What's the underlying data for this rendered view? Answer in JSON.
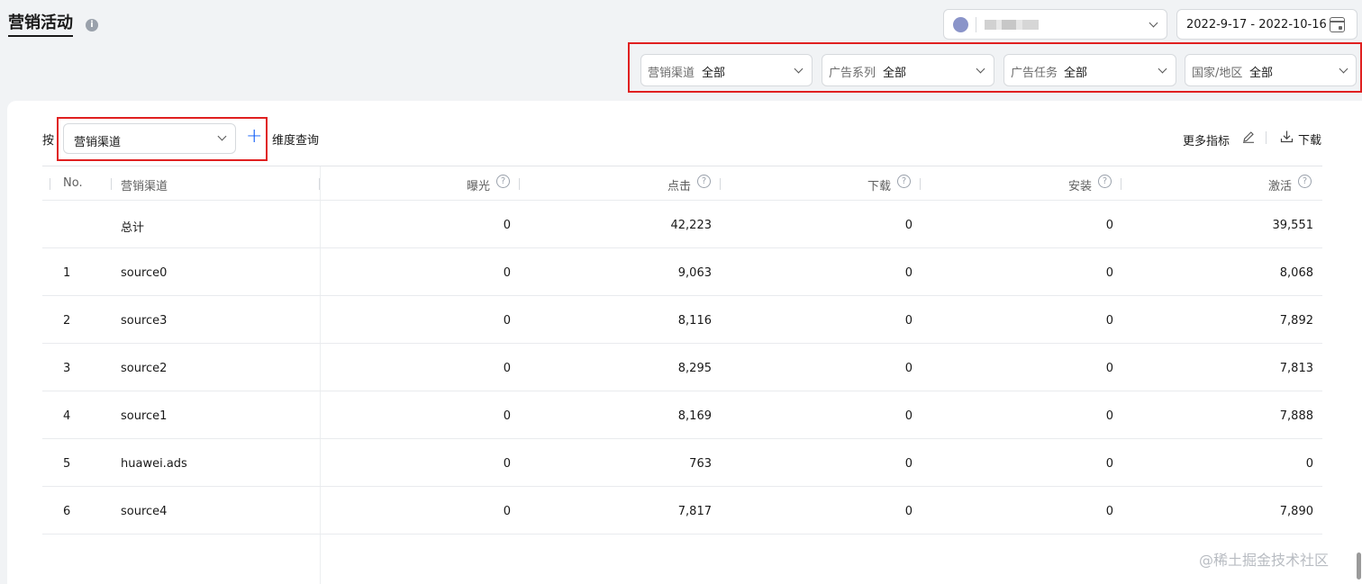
{
  "header": {
    "title": "营销活动",
    "info_icon": "info-icon",
    "date_range": "2022-9-17 - 2022-10-16"
  },
  "filters": [
    {
      "label": "营销渠道",
      "value": "全部"
    },
    {
      "label": "广告系列",
      "value": "全部"
    },
    {
      "label": "广告任务",
      "value": "全部"
    },
    {
      "label": "国家/地区",
      "value": "全部"
    }
  ],
  "toolbar": {
    "by_label": "按",
    "dimension_value": "营销渠道",
    "dimension_query": "维度查询",
    "more_metrics": "更多指标",
    "download": "下载"
  },
  "table": {
    "columns": [
      "No.",
      "营销渠道",
      "曝光",
      "点击",
      "下载",
      "安装",
      "激活"
    ],
    "total_row": {
      "label": "总计",
      "values": [
        "0",
        "42,223",
        "0",
        "0",
        "39,551"
      ]
    },
    "rows": [
      {
        "no": "1",
        "channel": "source0",
        "values": [
          "0",
          "9,063",
          "0",
          "0",
          "8,068"
        ]
      },
      {
        "no": "2",
        "channel": "source3",
        "values": [
          "0",
          "8,116",
          "0",
          "0",
          "7,892"
        ]
      },
      {
        "no": "3",
        "channel": "source2",
        "values": [
          "0",
          "8,295",
          "0",
          "0",
          "7,813"
        ]
      },
      {
        "no": "4",
        "channel": "source1",
        "values": [
          "0",
          "8,169",
          "0",
          "0",
          "7,888"
        ]
      },
      {
        "no": "5",
        "channel": "huawei.ads",
        "values": [
          "0",
          "763",
          "0",
          "0",
          "0"
        ]
      },
      {
        "no": "6",
        "channel": "source4",
        "values": [
          "0",
          "7,817",
          "0",
          "0",
          "7,890"
        ]
      }
    ]
  },
  "watermark": "@稀土掘金技术社区",
  "colors": {
    "highlight": "#e02020",
    "accent": "#0a59f7"
  }
}
